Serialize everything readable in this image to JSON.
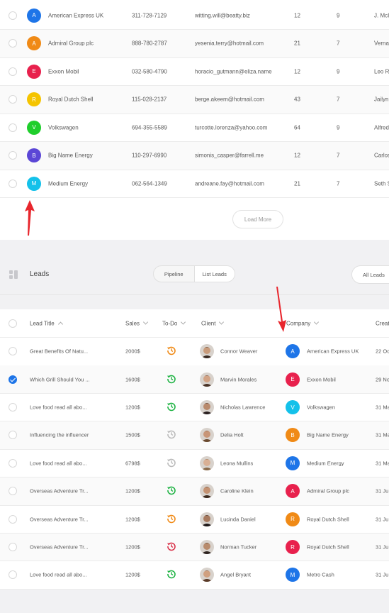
{
  "companies": {
    "rows": [
      {
        "letter": "A",
        "color": "#1e75e8",
        "name": "American Express UK",
        "phone": "311-728-7129",
        "email": "witting.will@beatty.biz",
        "n1": "12",
        "n2": "9",
        "contact": "J. McI"
      },
      {
        "letter": "A",
        "color": "#f08a16",
        "name": "Admiral Group plc",
        "phone": "888-780-2787",
        "email": "yesenia.terry@hotmail.com",
        "n1": "21",
        "n2": "7",
        "contact": "Verna"
      },
      {
        "letter": "E",
        "color": "#e8214d",
        "name": "Exxon Mobil",
        "phone": "032-580-4790",
        "email": "horacio_gutmann@eliza.name",
        "n1": "12",
        "n2": "9",
        "contact": "Leo Ry"
      },
      {
        "letter": "R",
        "color": "#f5c400",
        "name": "Royal Dutch Shell",
        "phone": "115-028-2137",
        "email": "berge.akeem@hotmail.com",
        "n1": "43",
        "n2": "7",
        "contact": "Jailyn"
      },
      {
        "letter": "V",
        "color": "#1fce2c",
        "name": "Volkswagen",
        "phone": "694-355-5589",
        "email": "turcotte.lorenza@yahoo.com",
        "n1": "64",
        "n2": "9",
        "contact": "Alfred"
      },
      {
        "letter": "B",
        "color": "#5b46d6",
        "name": "Big Name Energy",
        "phone": "110-297-6990",
        "email": "simonis_casper@farrell.me",
        "n1": "12",
        "n2": "7",
        "contact": "Carlos"
      },
      {
        "letter": "M",
        "color": "#14c1ea",
        "name": "Medium Energy",
        "phone": "062-564-1349",
        "email": "andreane.fay@hotmail.com",
        "n1": "21",
        "n2": "7",
        "contact": "Seth S"
      }
    ],
    "load_more_label": "Load More"
  },
  "leads": {
    "title": "Leads",
    "view_tabs": [
      "Pipeline",
      "List Leads"
    ],
    "active_tab": "List Leads",
    "filter_label": "All Leads",
    "headers": {
      "title": "Lead Title",
      "sales": "Sales",
      "todo": "To-Do",
      "client": "Client",
      "company": "Company",
      "created": "Creat"
    },
    "rows": [
      {
        "title": "Great Benefits Of Natu...",
        "sales": "2000$",
        "todo_color": "#f08a16",
        "client": "Connor Weaver",
        "skin": "#c89b7b",
        "hair": "#3a2a22",
        "letter": "A",
        "color": "#1e75e8",
        "company": "American Express UK",
        "date": "22 Oc",
        "checked": false
      },
      {
        "title": "Which Grill Should You ...",
        "sales": "1600$",
        "todo_color": "#1fb344",
        "client": "Marvin Morales",
        "skin": "#d2a385",
        "hair": "#4a3326",
        "letter": "E",
        "color": "#e8214d",
        "company": "Exxon Mobil",
        "date": "29 No",
        "checked": true
      },
      {
        "title": "Love food read all abo...",
        "sales": "1200$",
        "todo_color": "#1fb344",
        "client": "Nicholas Lawrence",
        "skin": "#b98a6c",
        "hair": "#2a2020",
        "letter": "V",
        "color": "#14c1ea",
        "company": "Volkswagen",
        "date": "31 Ma",
        "checked": false
      },
      {
        "title": "Influencing the influencer",
        "sales": "1500$",
        "todo_color": "#bbbbbb",
        "client": "Delia Holt",
        "skin": "#c89577",
        "hair": "#6b4a30",
        "letter": "B",
        "color": "#f08a16",
        "company": "Big Name Energy",
        "date": "31 Ma",
        "checked": false
      },
      {
        "title": "Love food read all abo...",
        "sales": "6798$",
        "todo_color": "#bbbbbb",
        "client": "Leona Mullins",
        "skin": "#d9b095",
        "hair": "#8a6a4a",
        "letter": "M",
        "color": "#1e75e8",
        "company": "Medium Energy",
        "date": "31 Ma",
        "checked": false
      },
      {
        "title": "Overseas Adventure Tr...",
        "sales": "1200$",
        "todo_color": "#1fb344",
        "client": "Caroline Klein",
        "skin": "#c49272",
        "hair": "#3c2a1e",
        "letter": "A",
        "color": "#e8214d",
        "company": "Admiral Group plc",
        "date": "31 Ju",
        "checked": false
      },
      {
        "title": "Overseas Adventure Tr...",
        "sales": "1200$",
        "todo_color": "#f08a16",
        "client": "Lucinda Daniel",
        "skin": "#a77a5f",
        "hair": "#1e1818",
        "letter": "R",
        "color": "#f08a16",
        "company": "Royal Dutch Shell",
        "date": "31 Ju",
        "checked": false
      },
      {
        "title": "Overseas Adventure Tr...",
        "sales": "1200$",
        "todo_color": "#d9334a",
        "client": "Norman Tucker",
        "skin": "#b88b6c",
        "hair": "#2e2420",
        "letter": "R",
        "color": "#e8214d",
        "company": "Royal Dutch Shell",
        "date": "31 Ju",
        "checked": false
      },
      {
        "title": "Love food read all abo...",
        "sales": "1200$",
        "todo_color": "#1fb344",
        "client": "Angel Bryant",
        "skin": "#d0a080",
        "hair": "#5a3a28",
        "letter": "M",
        "color": "#1e75e8",
        "company": "Metro Cash",
        "date": "31 Ju",
        "checked": false
      }
    ]
  }
}
